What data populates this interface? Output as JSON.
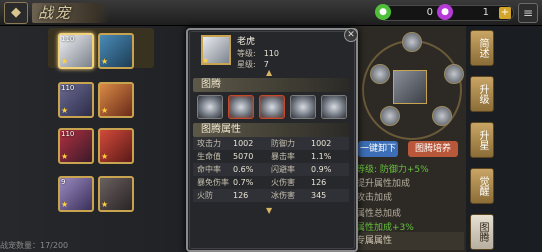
{
  "header": {
    "title": "战宠",
    "currency": [
      {
        "icon": "green-gem-icon",
        "value": "0",
        "color": "#4fbf3a"
      },
      {
        "icon": "purple-gem-icon",
        "value": "1",
        "color": "#b53bd6"
      }
    ]
  },
  "hero_list": {
    "items": [
      {
        "level": "110",
        "selected": true
      },
      {
        "level": "0",
        "selected": false
      },
      {
        "level": "110",
        "selected": false
      },
      {
        "level": "0",
        "selected": false
      },
      {
        "level": "110",
        "selected": false
      },
      {
        "level": "0",
        "selected": false
      },
      {
        "level": "9",
        "selected": false
      },
      {
        "level": "0",
        "selected": false
      }
    ],
    "count_label": "战宠数量：17/200"
  },
  "popup": {
    "name": "老虎",
    "level_label": "等级:",
    "level_value": "110",
    "star_label": "星级:",
    "star_value": "7",
    "totem_section": "图腾",
    "attr_section": "图腾属性",
    "attributes": [
      {
        "k1": "攻击力",
        "v1": "1002",
        "k2": "防御力",
        "v2": "1002"
      },
      {
        "k1": "生命值",
        "v1": "5070",
        "k2": "暴击率",
        "v2": "1.1%"
      },
      {
        "k1": "命中率",
        "v1": "0.6%",
        "k2": "闪避率",
        "v2": "0.9%"
      },
      {
        "k1": "暴免伤率",
        "v1": "0.7%",
        "k2": "火伤害",
        "v2": "126"
      },
      {
        "k1": "火防",
        "v1": "126",
        "k2": "冰伤害",
        "v2": "345"
      }
    ]
  },
  "right_panel": {
    "tabs": [
      "简述",
      "升级",
      "升星",
      "觉醒",
      "图腾"
    ],
    "buttons": {
      "unequip": "一键卸下",
      "develop": "图腾培养"
    },
    "lines": [
      {
        "text": "等级: 防御力+5%",
        "green": true
      },
      {
        "text": "提升属性加成",
        "green": false
      },
      {
        "text": "攻击加成",
        "green": false
      },
      {
        "text": "属性总加成",
        "green": false
      },
      {
        "text": "属性加成+3%",
        "green": true
      }
    ],
    "bottom_header": "专属属性"
  }
}
